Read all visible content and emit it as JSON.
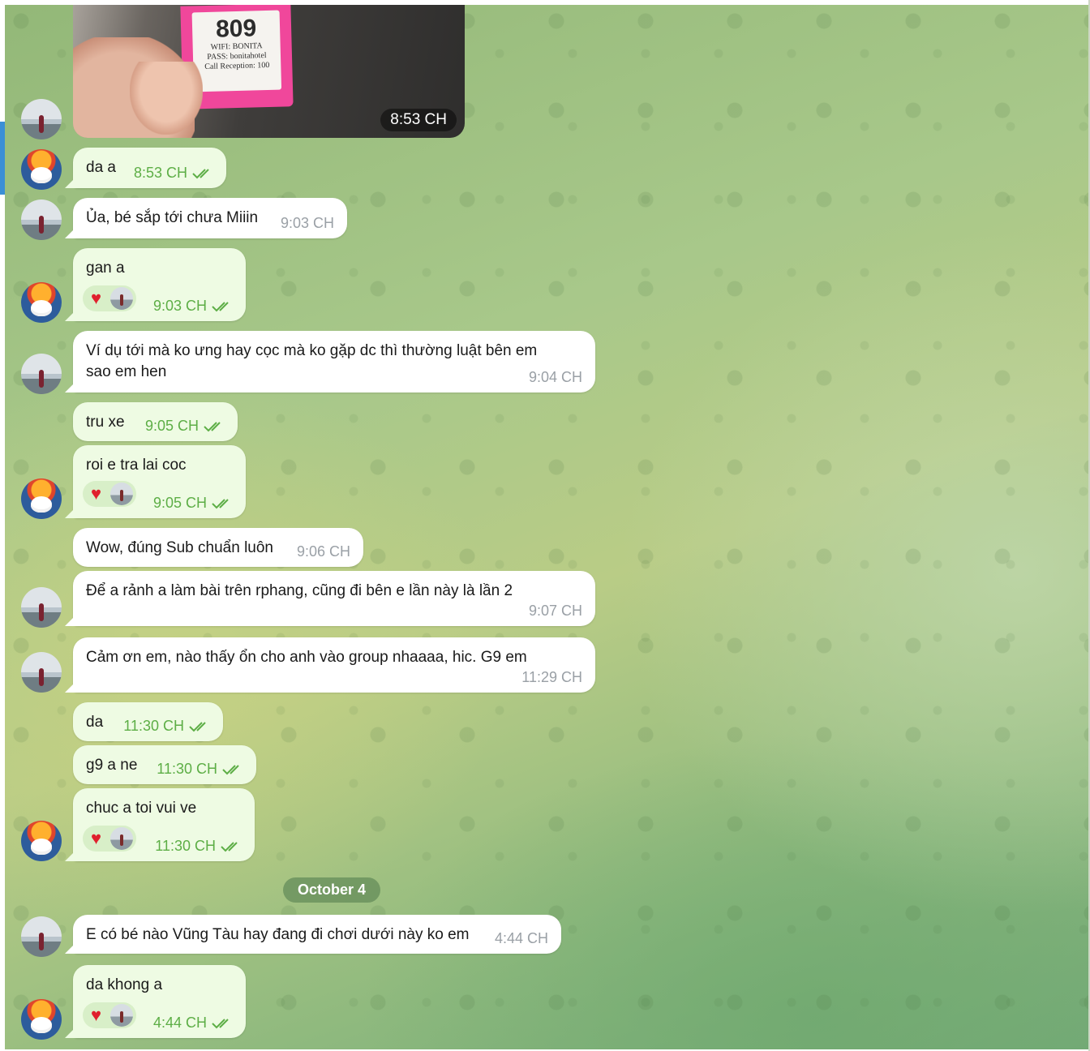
{
  "chat": {
    "photo": {
      "room_number": "809",
      "card_line1": "WIFI: BONITA",
      "card_line2": "PASS: bonitahotel",
      "card_line3": "Call Reception: 100",
      "time": "8:53 CH"
    },
    "messages": [
      {
        "text": "da a",
        "time": "8:53 CH"
      },
      {
        "text": "Ủa, bé sắp tới chưa Miiin",
        "time": "9:03 CH"
      },
      {
        "text": "gan a",
        "time": "9:03 CH",
        "reaction": "♥"
      },
      {
        "text": "Ví dụ tới mà ko ưng hay cọc mà ko gặp dc thì thường luật bên em\nsao em hen",
        "time": "9:04 CH"
      },
      {
        "text": "tru xe",
        "time": "9:05 CH"
      },
      {
        "text": "roi e tra lai coc",
        "time": "9:05 CH",
        "reaction": "♥"
      },
      {
        "text": "Wow, đúng Sub chuẩn luôn",
        "time": "9:06 CH"
      },
      {
        "text": "Để a rảnh a làm bài trên rphang, cũng đi bên e lần này là lần 2",
        "time": "9:07 CH"
      },
      {
        "text": "Cảm ơn em, nào thấy ổn cho anh vào group nhaaaa, hic. G9 em",
        "time": "11:29 CH"
      },
      {
        "text": "da",
        "time": "11:30 CH"
      },
      {
        "text": "g9 a ne",
        "time": "11:30 CH"
      },
      {
        "text": "chuc a toi vui ve",
        "time": "11:30 CH",
        "reaction": "♥"
      },
      {
        "text": "E có bé nào Vũng Tàu hay đang đi chơi dưới này ko em",
        "time": "4:44 CH"
      },
      {
        "text": "da khong a",
        "time": "4:44 CH",
        "reaction": "♥"
      }
    ],
    "date_separator": "October 4",
    "colors": {
      "outgoing_bubble": "#eefbe3",
      "incoming_bubble": "#ffffff",
      "check": "#5dae46",
      "heart": "#e0202d"
    }
  }
}
